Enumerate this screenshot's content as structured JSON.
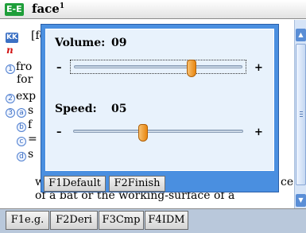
{
  "header": {
    "mode_tag": "E-E",
    "headword": "face",
    "headword_sup": "1"
  },
  "entry": {
    "pron_tag": "KK",
    "pronunciation": "[fes]",
    "pos": "n",
    "markers": [
      "1",
      "2",
      "3",
      "a",
      "b",
      "c",
      "d"
    ],
    "lines": {
      "l1": "fro",
      "l2": "for",
      "l3": "exp",
      "l4": "s",
      "l5": "f",
      "l6": "=",
      "l7": "s",
      "l8_left": "w",
      "l8_right": "ce",
      "l9": "of a bat or the working-surface of a"
    }
  },
  "dialog": {
    "volume_label": "Volume:",
    "volume_value": "09",
    "volume_level": 0.69,
    "speed_label": "Speed:",
    "speed_value": "05",
    "speed_level": 0.41,
    "minus": "–",
    "plus": "+",
    "buttons": [
      "F1Default",
      "F2Finish"
    ]
  },
  "footer": {
    "buttons": [
      "F1e.g.",
      "F2Deri",
      "F3Cmp",
      "F4IDM"
    ]
  },
  "scrollbar": {
    "up_icon": "▲",
    "down_icon": "▼"
  },
  "colors": {
    "dialog_frame": "#4a8fe0",
    "dialog_body": "#e8f2fc",
    "slider_thumb": "#e8860f",
    "mode_tag": "#1e9e3a",
    "pron_tag": "#3b70c4",
    "pos": "#d21414"
  }
}
